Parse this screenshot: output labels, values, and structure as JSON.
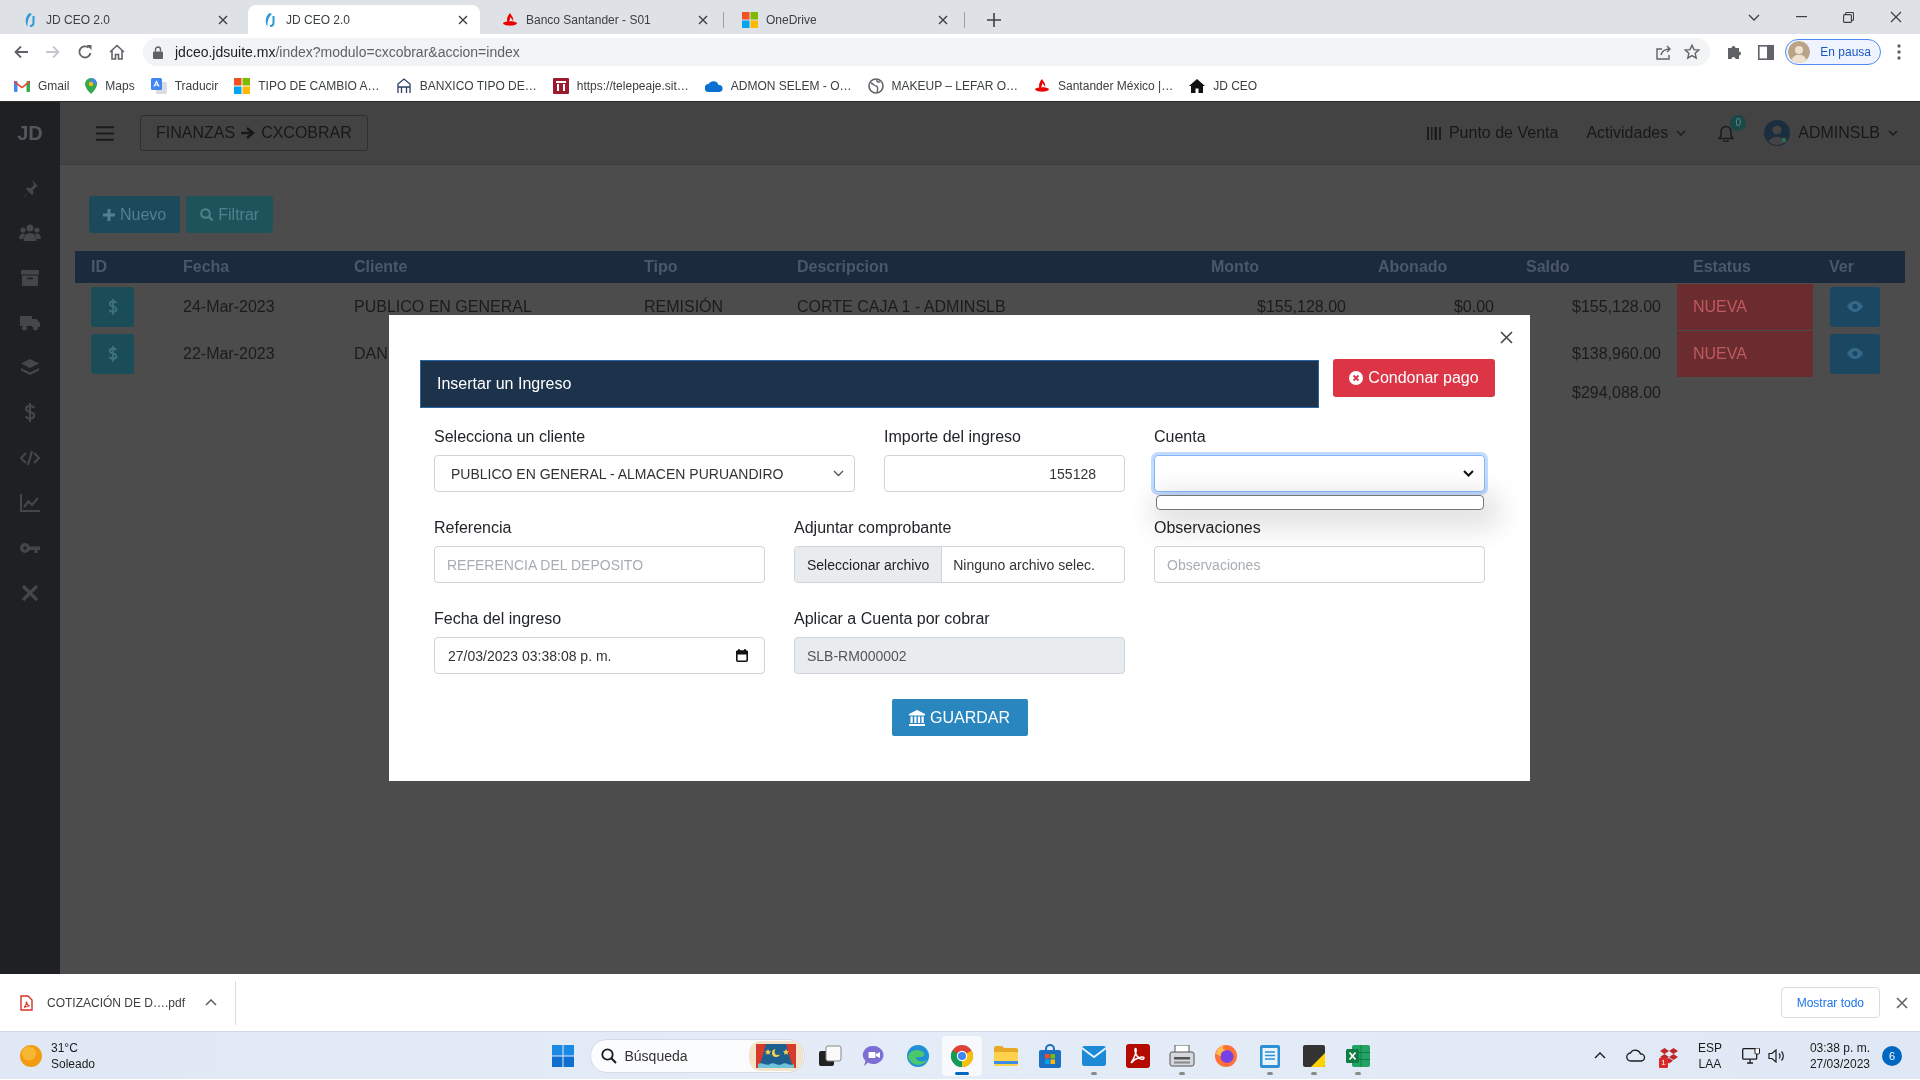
{
  "browser": {
    "tabs": [
      {
        "kind": "jd",
        "title": "JD CEO 2.0",
        "selected": false
      },
      {
        "kind": "jd",
        "title": "JD CEO 2.0",
        "selected": true
      },
      {
        "kind": "santander",
        "title": "Banco Santander - S01",
        "selected": false
      },
      {
        "kind": "microsoft",
        "title": "OneDrive",
        "selected": false
      }
    ],
    "toolbar": {
      "forward_disabled": true,
      "url_host": "jdceo.jdsuite.mx",
      "url_path": "/index?modulo=cxcobrar&accion=index",
      "profile_status": "En pausa"
    },
    "bookmarks": [
      {
        "kind": "gmail",
        "label": "Gmail"
      },
      {
        "kind": "maps",
        "label": "Maps"
      },
      {
        "kind": "translate",
        "label": "Traducir"
      },
      {
        "kind": "microsoft",
        "label": "TIPO DE CAMBIO A…"
      },
      {
        "kind": "banxico",
        "label": "BANXICO TIPO DE…"
      },
      {
        "kind": "telepeaje",
        "label": "https://telepeaje.sit…"
      },
      {
        "kind": "onedrive",
        "label": "ADMON SELEM - O…"
      },
      {
        "kind": "globe",
        "label": "MAKEUP – LEFAR O…"
      },
      {
        "kind": "santander",
        "label": "Santander México |…"
      },
      {
        "kind": "home",
        "label": "JD CEO"
      }
    ]
  },
  "app": {
    "logo": "JD",
    "breadcrumb": {
      "section": "FINANZAS",
      "page": "CXCOBRAR"
    },
    "navbar": {
      "pos_link": "Punto de Venta",
      "activities": "Actividades",
      "notifications_count": "0",
      "user": "ADMINSLB"
    },
    "actions": [
      {
        "kind": "add",
        "label": "Nuevo"
      },
      {
        "kind": "filter",
        "label": "Filtrar"
      }
    ],
    "table": {
      "columns": [
        "ID",
        "Fecha",
        "Cliente",
        "Tipo",
        "Descripcion",
        "Monto",
        "Abonado",
        "Saldo",
        "Estatus",
        "Ver"
      ],
      "rows": [
        {
          "fecha": "24-Mar-2023",
          "cliente": "PUBLICO EN GENERAL",
          "tipo": "REMISIÓN",
          "descripcion": "CORTE CAJA 1 - ADMINSLB",
          "monto": "$155,128.00",
          "abonado": "$0.00",
          "saldo": "$155,128.00",
          "estatus": "NUEVA"
        },
        {
          "fecha": "22-Mar-2023",
          "cliente": "DAN",
          "saldo": "$138,960.00",
          "estatus": "NUEVA"
        }
      ],
      "total": "$294,088.00"
    }
  },
  "modal": {
    "title": "Insertar un Ingreso",
    "waive_button": "Condonar pago",
    "submit_button": "GUARDAR",
    "rows": [
      [
        {
          "kind": "select",
          "label": "Selecciona un cliente",
          "value": "PUBLICO EN GENERAL - ALMACEN PURUANDIRO",
          "focused": false,
          "expanded": false,
          "disabled": false
        },
        {
          "kind": "number",
          "label": "Importe del ingreso",
          "value": "155128",
          "focused": false,
          "disabled": false
        },
        {
          "kind": "select",
          "label": "Cuenta",
          "focused": true,
          "expanded": true,
          "disabled": false
        }
      ],
      [
        {
          "kind": "text",
          "label": "Referencia",
          "placeholder": "REFERENCIA DEL DEPOSITO",
          "focused": false,
          "disabled": false
        },
        {
          "kind": "file",
          "label": "Adjuntar comprobante",
          "button": "Seleccionar archivo",
          "value": "Ninguno archivo selec.",
          "focused": false,
          "disabled": false
        },
        {
          "kind": "text",
          "label": "Observaciones",
          "placeholder": "Observaciones",
          "focused": false,
          "disabled": false
        }
      ],
      [
        {
          "kind": "datetime",
          "label": "Fecha del ingreso",
          "value": "27/03/2023 03:38:08 p. m.",
          "focused": false,
          "disabled": false
        },
        {
          "kind": "text",
          "label": "Aplicar a Cuenta por cobrar",
          "value": "SLB-RM000002",
          "focused": false,
          "disabled": true
        }
      ]
    ]
  },
  "downloads": {
    "file": "COTIZACIÓN DE D….pdf",
    "show_all": "Mostrar todo"
  },
  "taskbar": {
    "weather": {
      "temperature": "31°C",
      "condition": "Soleado"
    },
    "search_placeholder": "Búsqueda",
    "apps": [
      {
        "kind": "taskview",
        "running": false,
        "selected": false
      },
      {
        "kind": "chat",
        "running": false,
        "selected": false
      },
      {
        "kind": "edge",
        "running": false,
        "selected": false
      },
      {
        "kind": "chrome",
        "running": true,
        "selected": true
      },
      {
        "kind": "explorer",
        "running": false,
        "selected": false
      },
      {
        "kind": "store",
        "running": false,
        "selected": false
      },
      {
        "kind": "mail",
        "running": true,
        "selected": false
      },
      {
        "kind": "acrobat",
        "running": false,
        "selected": false
      },
      {
        "kind": "register",
        "running": true,
        "selected": false
      },
      {
        "kind": "firefox",
        "running": false,
        "selected": false
      },
      {
        "kind": "notepad",
        "running": true,
        "selected": false
      },
      {
        "kind": "sticky",
        "running": true,
        "selected": false
      },
      {
        "kind": "excel",
        "running": true,
        "selected": false
      }
    ],
    "tray": {
      "badge": "1",
      "language": "ESP",
      "layout": "LAA",
      "time": "03:38 p. m.",
      "date": "27/03/2023",
      "notifications": "6"
    }
  }
}
